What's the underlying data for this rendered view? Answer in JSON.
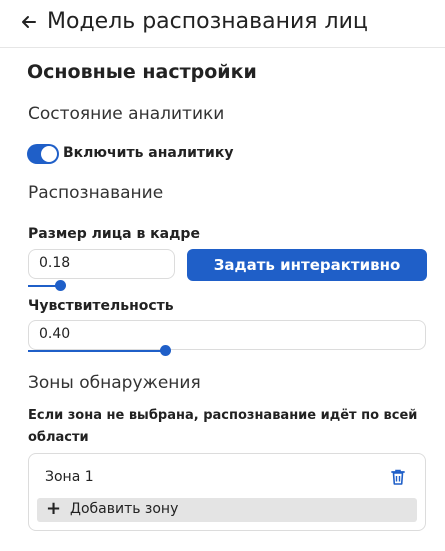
{
  "header": {
    "title": "Модель распознавания лиц"
  },
  "main_section": {
    "title": "Основные настройки"
  },
  "analytics": {
    "heading": "Состояние аналитики",
    "toggle_label": "Включить аналитику",
    "toggle_on": true
  },
  "recognition": {
    "heading": "Распознавание",
    "face_size": {
      "label": "Размер лица в кадре",
      "value": "0.18"
    },
    "set_interactive_label": "Задать интерактивно",
    "sensitivity": {
      "label": "Чувствительность",
      "value": "0.40"
    }
  },
  "zones": {
    "heading": "Зоны обнаружения",
    "note": "Если зона не выбрана, распознавание идёт по всей области",
    "items": [
      {
        "name": "Зона 1"
      }
    ],
    "add_label": "Добавить зону"
  },
  "colors": {
    "accent": "#1f5fc8"
  }
}
